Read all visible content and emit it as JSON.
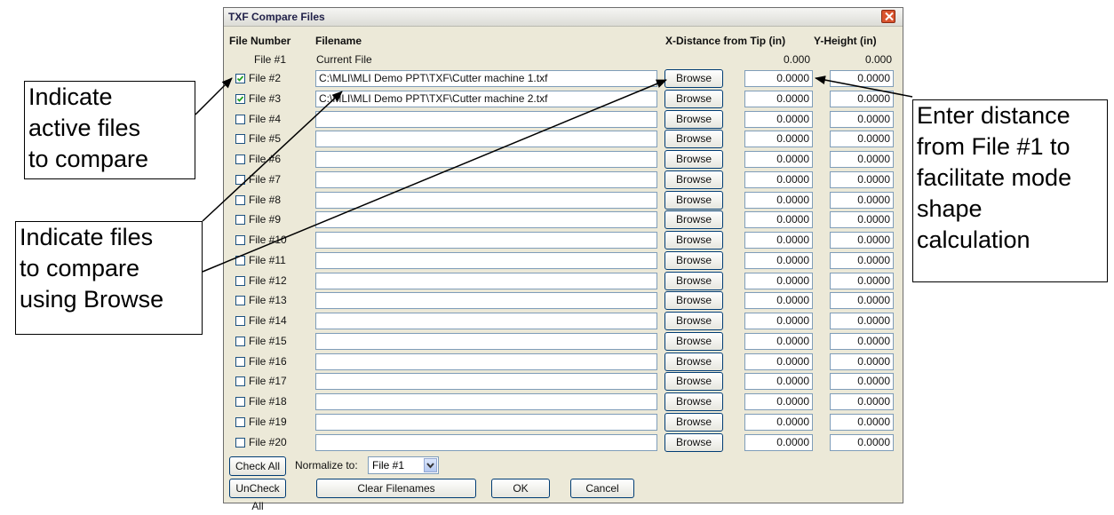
{
  "dialog": {
    "title": "TXF Compare Files",
    "headers": {
      "file_number": "File Number",
      "filename": "Filename",
      "x_distance": "X-Distance from Tip (in)",
      "y_height": "Y-Height (in)"
    },
    "current_row": {
      "label": "File #1",
      "filename": "Current File",
      "x": "0.000",
      "y": "0.000"
    },
    "rows": [
      {
        "label": "File #2",
        "checked": true,
        "filename": "C:\\MLI\\MLI Demo PPT\\TXF\\Cutter machine 1.txf",
        "browse": "Browse",
        "x": "0.0000",
        "y": "0.0000"
      },
      {
        "label": "File #3",
        "checked": true,
        "filename": "C:\\MLI\\MLI Demo PPT\\TXF\\Cutter machine 2.txf",
        "browse": "Browse",
        "x": "0.0000",
        "y": "0.0000"
      },
      {
        "label": "File #4",
        "checked": false,
        "filename": "",
        "browse": "Browse",
        "x": "0.0000",
        "y": "0.0000"
      },
      {
        "label": "File #5",
        "checked": false,
        "filename": "",
        "browse": "Browse",
        "x": "0.0000",
        "y": "0.0000"
      },
      {
        "label": "File #6",
        "checked": false,
        "filename": "",
        "browse": "Browse",
        "x": "0.0000",
        "y": "0.0000"
      },
      {
        "label": "File #7",
        "checked": false,
        "filename": "",
        "browse": "Browse",
        "x": "0.0000",
        "y": "0.0000"
      },
      {
        "label": "File #8",
        "checked": false,
        "filename": "",
        "browse": "Browse",
        "x": "0.0000",
        "y": "0.0000"
      },
      {
        "label": "File #9",
        "checked": false,
        "filename": "",
        "browse": "Browse",
        "x": "0.0000",
        "y": "0.0000"
      },
      {
        "label": "File #10",
        "checked": false,
        "filename": "",
        "browse": "Browse",
        "x": "0.0000",
        "y": "0.0000"
      },
      {
        "label": "File #11",
        "checked": false,
        "filename": "",
        "browse": "Browse",
        "x": "0.0000",
        "y": "0.0000"
      },
      {
        "label": "File #12",
        "checked": false,
        "filename": "",
        "browse": "Browse",
        "x": "0.0000",
        "y": "0.0000"
      },
      {
        "label": "File #13",
        "checked": false,
        "filename": "",
        "browse": "Browse",
        "x": "0.0000",
        "y": "0.0000"
      },
      {
        "label": "File #14",
        "checked": false,
        "filename": "",
        "browse": "Browse",
        "x": "0.0000",
        "y": "0.0000"
      },
      {
        "label": "File #15",
        "checked": false,
        "filename": "",
        "browse": "Browse",
        "x": "0.0000",
        "y": "0.0000"
      },
      {
        "label": "File #16",
        "checked": false,
        "filename": "",
        "browse": "Browse",
        "x": "0.0000",
        "y": "0.0000"
      },
      {
        "label": "File #17",
        "checked": false,
        "filename": "",
        "browse": "Browse",
        "x": "0.0000",
        "y": "0.0000"
      },
      {
        "label": "File #18",
        "checked": false,
        "filename": "",
        "browse": "Browse",
        "x": "0.0000",
        "y": "0.0000"
      },
      {
        "label": "File #19",
        "checked": false,
        "filename": "",
        "browse": "Browse",
        "x": "0.0000",
        "y": "0.0000"
      },
      {
        "label": "File #20",
        "checked": false,
        "filename": "",
        "browse": "Browse",
        "x": "0.0000",
        "y": "0.0000"
      }
    ],
    "buttons": {
      "check_all": "Check All",
      "uncheck_all": "UnCheck All",
      "clear_filenames": "Clear Filenames",
      "ok": "OK",
      "cancel": "Cancel"
    },
    "normalize": {
      "label": "Normalize to:",
      "selected": "File #1"
    },
    "icons": {
      "close": "close-icon",
      "checkbox_check": "checkmark-icon",
      "dropdown": "chevron-down-icon"
    }
  },
  "callouts": {
    "active_files": [
      "Indicate",
      "active files",
      "to compare"
    ],
    "browse_files": [
      "Indicate files",
      "to compare",
      "using Browse"
    ],
    "distance": [
      "Enter distance",
      "from File #1 to",
      "facilitate mode",
      "shape",
      "calculation"
    ]
  },
  "colors": {
    "dialog_bg": "#ece9d8",
    "close_button": "#d9542f",
    "check_green": "#21a121",
    "input_border": "#7f9db9"
  }
}
